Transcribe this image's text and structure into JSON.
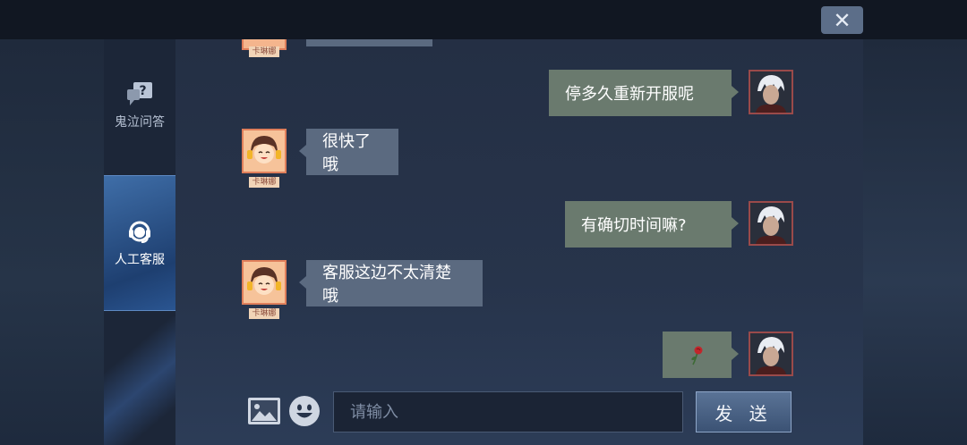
{
  "window": {
    "close_label": "✕"
  },
  "sidebar": {
    "items": [
      {
        "label": "鬼泣问答",
        "icon": "question-chat-icon"
      },
      {
        "label": "人工客服",
        "icon": "headset-icon",
        "active": true
      }
    ]
  },
  "chat": {
    "agent_name": "卡琳娜",
    "messages": [
      {
        "from": "me",
        "text": "停多久重新开服呢"
      },
      {
        "from": "agent",
        "text": "很快了哦"
      },
      {
        "from": "me",
        "text": "有确切时间嘛?"
      },
      {
        "from": "agent",
        "text": "客服这边不太清楚哦"
      },
      {
        "from": "me",
        "text": "",
        "sticker": "rose-icon"
      }
    ]
  },
  "composer": {
    "placeholder": "请输入",
    "send_label": "发 送",
    "image_icon": "image-icon",
    "emoji_icon": "emoji-icon"
  },
  "colors": {
    "accent": "#3f6ea8",
    "agent_bubble": "#5b6a80",
    "my_bubble": "#6a7a6e"
  }
}
